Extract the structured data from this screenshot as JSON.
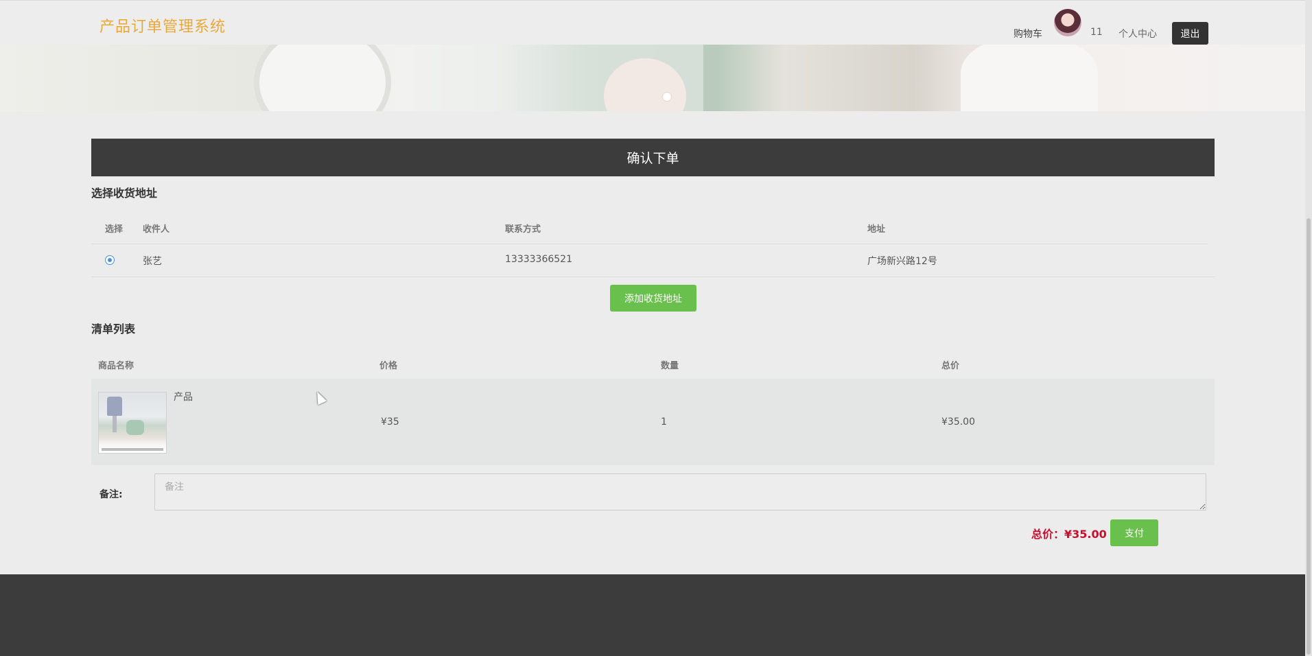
{
  "header": {
    "logo": "产品订单管理系统",
    "cart_label": "购物车",
    "username": "11",
    "user_center_label": "个人中心",
    "logout_label": "退出"
  },
  "title_bar": "确认下单",
  "address_section": {
    "heading": "选择收货地址",
    "columns": [
      "选择",
      "收件人",
      "联系方式",
      "地址"
    ],
    "rows": [
      {
        "recipient": "张艺",
        "phone": "13333366521",
        "address": "广场新兴路12号"
      }
    ],
    "add_button": "添加收货地址"
  },
  "order_section": {
    "heading": "清单列表",
    "columns": [
      "商品名称",
      "价格",
      "数量",
      "总价"
    ],
    "items": [
      {
        "name": "产品",
        "price": "¥35",
        "quantity": "1",
        "total": "¥35.00"
      }
    ]
  },
  "remark": {
    "label": "备注:",
    "placeholder": "备注"
  },
  "summary": {
    "total_text": "总价：¥35.00",
    "pay_button": "支付"
  },
  "colors": {
    "accent_green": "#6ac04d",
    "title_bar_bg": "#3c3c3c",
    "logo": "#e8a93a",
    "total_red": "#c3102f"
  }
}
